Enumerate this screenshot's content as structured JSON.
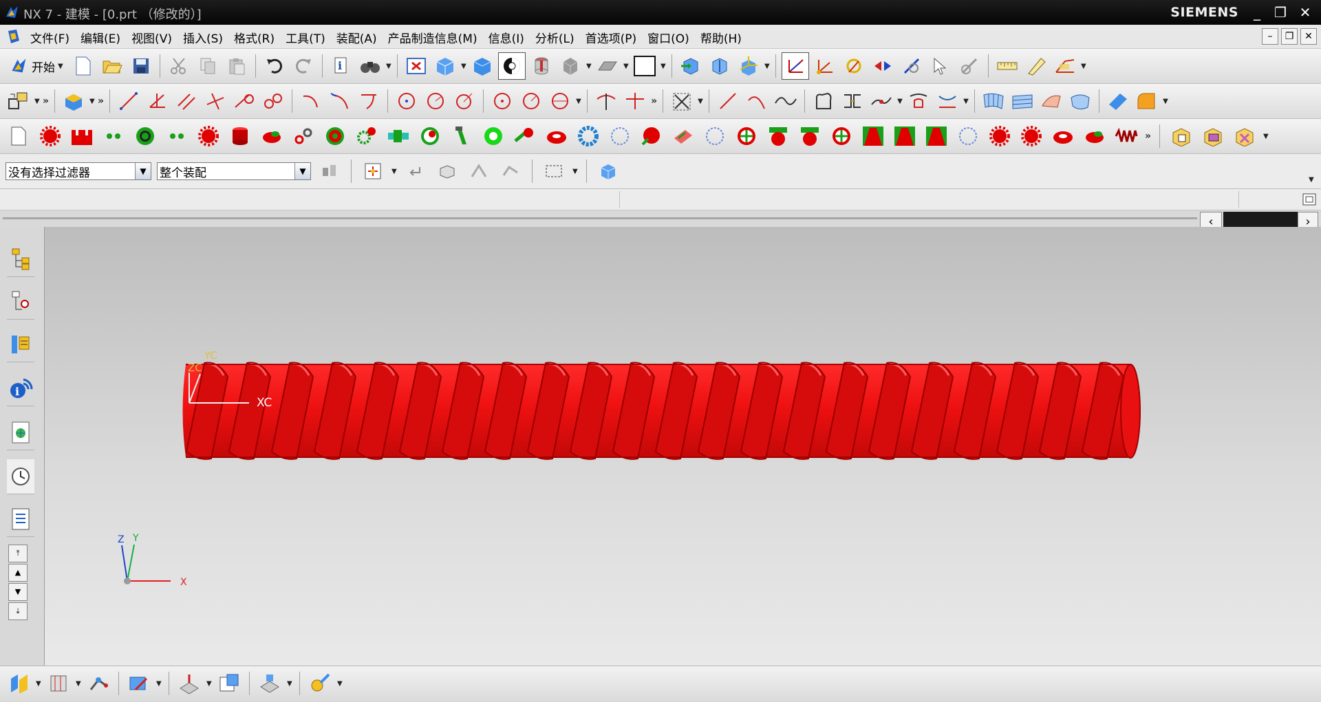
{
  "window": {
    "title": "NX 7 - 建模 - [0.prt （修改的）]",
    "brand": "SIEMENS",
    "minimize": "_",
    "restore": "❐",
    "close": "✕"
  },
  "menubar": {
    "items": [
      "文件(F)",
      "编辑(E)",
      "视图(V)",
      "插入(S)",
      "格式(R)",
      "工具(T)",
      "装配(A)",
      "产品制造信息(M)",
      "信息(I)",
      "分析(L)",
      "首选项(P)",
      "窗口(O)",
      "帮助(H)"
    ]
  },
  "toolbar1": {
    "start_label": "开始",
    "overflow": "»"
  },
  "toolbar2": {
    "overflow": "»"
  },
  "toolbar3": {
    "overflow": "»"
  },
  "filterbar": {
    "selection_filter": "没有选择过滤器",
    "assembly_scope": "整个装配"
  },
  "viewport": {
    "wcs_labels": {
      "zc": "ZC",
      "yc": "YC",
      "xc": "XC"
    },
    "abs_labels": {
      "z": "Z",
      "y": "Y",
      "x": "X"
    },
    "model_color": "#ee1111",
    "model": "threaded-screw-shaft"
  },
  "colors": {
    "accent_red": "#e00000",
    "accent_green": "#18a018",
    "title_bar": "#111111",
    "toolbar_bg": "#e6e6e6"
  }
}
